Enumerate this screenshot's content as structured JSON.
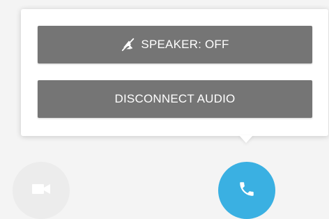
{
  "popover": {
    "speaker_button": {
      "label": "SPEAKER: OFF",
      "icon": "speaker-off-icon"
    },
    "disconnect_button": {
      "label": "DISCONNECT AUDIO"
    }
  },
  "controls": {
    "video_button": {
      "icon": "video-camera-icon",
      "state": "disabled"
    },
    "audio_button": {
      "icon": "phone-icon",
      "state": "active"
    }
  },
  "colors": {
    "button_gray": "#757575",
    "audio_active_blue": "#3ab0e2",
    "video_inactive": "#ececec",
    "background": "#f4f4f4",
    "popover_bg": "#ffffff"
  }
}
